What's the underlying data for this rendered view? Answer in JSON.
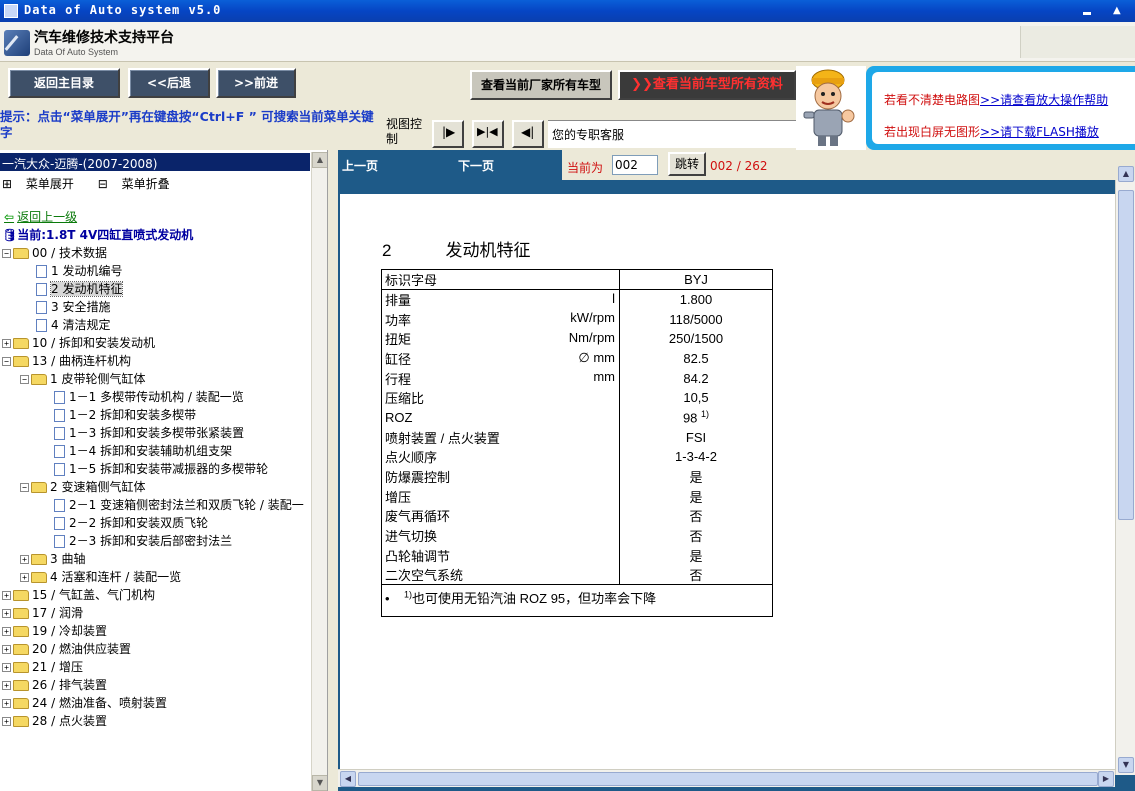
{
  "window": {
    "title": "Data of Auto system v5.0"
  },
  "header": {
    "app_title": "汽车维修技术支持平台",
    "app_subtitle": "Data Of Auto System"
  },
  "toolbar": {
    "main_menu": "返回主目录",
    "back": "<<后退",
    "forward": ">>前进",
    "all_models": "查看当前厂家所有车型",
    "all_data": "查看当前车型所有资料"
  },
  "tip": {
    "text": "提示：点击“菜单展开”再在键盘按“Ctrl+F ” 可搜索当前菜单关键字",
    "view_control": "视图控制",
    "service": "您的专职客服"
  },
  "help": {
    "line1_prefix": "若看不清楚电路图",
    "line1_link": ">>请查看放大操作帮助",
    "line2_prefix": "若出现白屏无图形",
    "line2_link": ">>请下载FLASH播放"
  },
  "left": {
    "header": "一汽大众-迈腾-(2007-2008)",
    "expand": "菜单展开",
    "collapse": "菜单折叠",
    "back": "返回上一级",
    "current": "当前:1.8T 4V四缸直喷式发动机",
    "tree": [
      {
        "label": "00 / 技术数据",
        "type": "folder",
        "exp": "−",
        "indent": 0
      },
      {
        "label": "1 发动机编号",
        "type": "page",
        "indent": 2
      },
      {
        "label": "2 发动机特征",
        "type": "page",
        "indent": 2,
        "selected": true
      },
      {
        "label": "3 安全措施",
        "type": "page",
        "indent": 2
      },
      {
        "label": "4 清洁规定",
        "type": "page",
        "indent": 2
      },
      {
        "label": "10 / 拆卸和安装发动机",
        "type": "folder",
        "exp": "+",
        "indent": 0
      },
      {
        "label": "13 / 曲柄连杆机构",
        "type": "folder",
        "exp": "−",
        "indent": 0
      },
      {
        "label": "1 皮带轮侧气缸体",
        "type": "folder",
        "exp": "−",
        "indent": 1
      },
      {
        "label": "1－1 多楔带传动机构 / 装配一览",
        "type": "page",
        "indent": 3
      },
      {
        "label": "1－2 拆卸和安装多楔带",
        "type": "page",
        "indent": 3
      },
      {
        "label": "1－3 拆卸和安装多楔带张紧装置",
        "type": "page",
        "indent": 3
      },
      {
        "label": "1－4 拆卸和安装辅助机组支架",
        "type": "page",
        "indent": 3
      },
      {
        "label": "1－5 拆卸和安装带减振器的多楔带轮",
        "type": "page",
        "indent": 3
      },
      {
        "label": "2 变速箱侧气缸体",
        "type": "folder",
        "exp": "−",
        "indent": 1
      },
      {
        "label": "2－1 变速箱侧密封法兰和双质飞轮 / 装配一",
        "type": "page",
        "indent": 3
      },
      {
        "label": "2－2 拆卸和安装双质飞轮",
        "type": "page",
        "indent": 3
      },
      {
        "label": "2－3 拆卸和安装后部密封法兰",
        "type": "page",
        "indent": 3
      },
      {
        "label": "3 曲轴",
        "type": "folder",
        "exp": "+",
        "indent": 1
      },
      {
        "label": "4 活塞和连杆 / 装配一览",
        "type": "folder",
        "exp": "+",
        "indent": 1
      },
      {
        "label": "15 / 气缸盖、气门机构",
        "type": "folder",
        "exp": "+",
        "indent": 0
      },
      {
        "label": "17 / 润滑",
        "type": "folder",
        "exp": "+",
        "indent": 0
      },
      {
        "label": "19 / 冷却装置",
        "type": "folder",
        "exp": "+",
        "indent": 0
      },
      {
        "label": "20 / 燃油供应装置",
        "type": "folder",
        "exp": "+",
        "indent": 0
      },
      {
        "label": "21 / 增压",
        "type": "folder",
        "exp": "+",
        "indent": 0
      },
      {
        "label": "26 / 排气装置",
        "type": "folder",
        "exp": "+",
        "indent": 0
      },
      {
        "label": "24 / 燃油准备、喷射装置",
        "type": "folder",
        "exp": "+",
        "indent": 0
      },
      {
        "label": "28 / 点火装置",
        "type": "folder",
        "exp": "+",
        "indent": 0
      }
    ]
  },
  "nav": {
    "prev": "上一页",
    "next": "下一页",
    "current_label": "当前为",
    "page_value": "002",
    "jump": "跳转",
    "count": "002 / 262"
  },
  "doc": {
    "section_num": "2",
    "section_title": "发动机特征",
    "header_label": "标识字母",
    "header_value": "BYJ",
    "rows": [
      {
        "label": "排量",
        "unit": "l",
        "value": "1.800"
      },
      {
        "label": "功率",
        "unit": "kW/rpm",
        "value": "118/5000"
      },
      {
        "label": "扭矩",
        "unit": "Nm/rpm",
        "value": "250/1500"
      },
      {
        "label": "缸径",
        "unit": "∅ mm",
        "value": "82.5"
      },
      {
        "label": "行程",
        "unit": "mm",
        "value": "84.2"
      },
      {
        "label": "压缩比",
        "unit": "",
        "value": "10,5"
      },
      {
        "label": "ROZ",
        "unit": "",
        "value": "98",
        "sup": "1)"
      },
      {
        "label": "喷射装置 / 点火装置",
        "unit": "",
        "value": "FSI"
      },
      {
        "label": "点火顺序",
        "unit": "",
        "value": "1-3-4-2"
      },
      {
        "label": "防爆震控制",
        "unit": "",
        "value": "是"
      },
      {
        "label": "增压",
        "unit": "",
        "value": "是"
      },
      {
        "label": "废气再循环",
        "unit": "",
        "value": "否"
      },
      {
        "label": "进气切换",
        "unit": "",
        "value": "否"
      },
      {
        "label": "凸轮轴调节",
        "unit": "",
        "value": "是"
      },
      {
        "label": "二次空气系统",
        "unit": "",
        "value": "否"
      }
    ],
    "note_bullet": "•",
    "note_sup": "1)",
    "note_text": "也可使用无铅汽油 ROZ 95，但功率会下降"
  }
}
